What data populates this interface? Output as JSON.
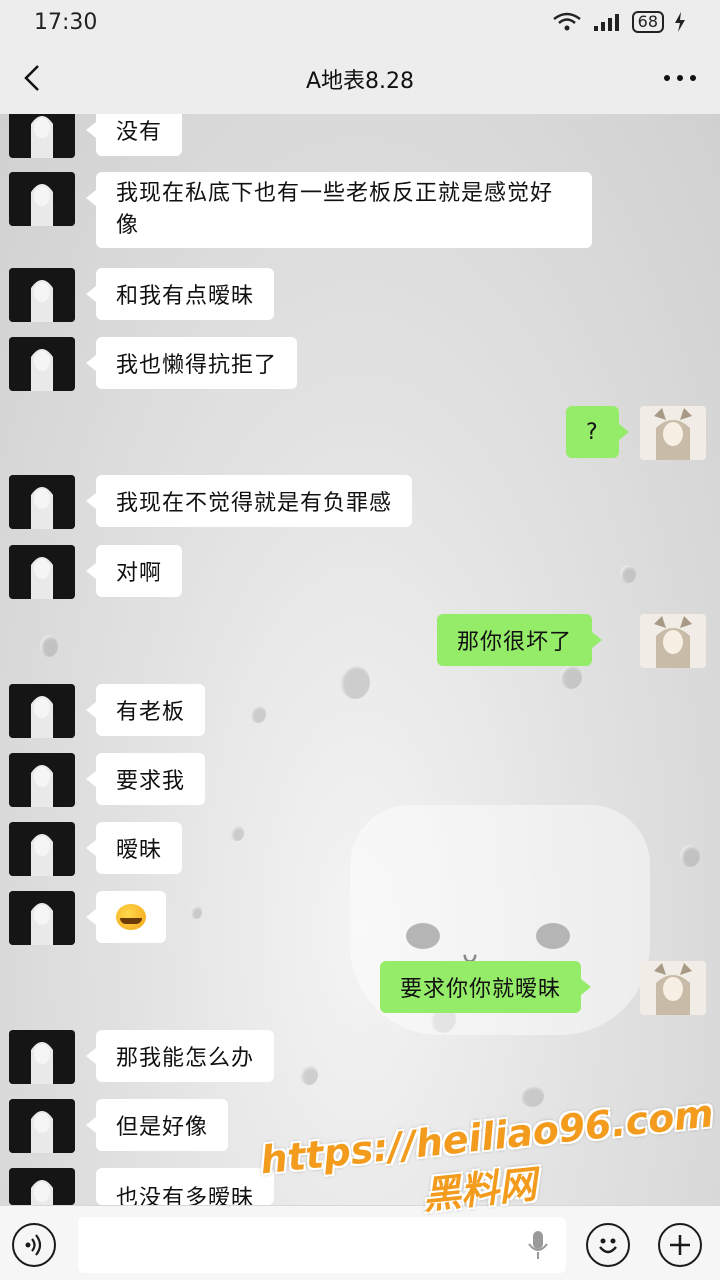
{
  "status": {
    "time": "17:30",
    "battery": "68"
  },
  "header": {
    "title": "A地表8.28"
  },
  "messages": [
    {
      "side": "other",
      "text": "没有"
    },
    {
      "side": "other",
      "text": "我现在私底下也有一些老板反正就是感觉好像"
    },
    {
      "side": "other",
      "text": "和我有点暧昧"
    },
    {
      "side": "other",
      "text": "我也懒得抗拒了"
    },
    {
      "side": "me",
      "text": "?"
    },
    {
      "side": "other",
      "text": "我现在不觉得就是有负罪感"
    },
    {
      "side": "other",
      "text": "对啊"
    },
    {
      "side": "me",
      "text": "那你很坏了"
    },
    {
      "side": "other",
      "text": "有老板"
    },
    {
      "side": "other",
      "text": "要求我"
    },
    {
      "side": "other",
      "text": "暧昧"
    },
    {
      "side": "other",
      "emoji": "laughing-crying-emoji"
    },
    {
      "side": "me",
      "text": "要求你你就暧昧"
    },
    {
      "side": "other",
      "text": "那我能怎么办"
    },
    {
      "side": "other",
      "text": "但是好像"
    },
    {
      "side": "other",
      "text": "也没有多暧昧"
    }
  ],
  "watermark": {
    "url": "https://heiliao96.com",
    "name": "黑料网"
  },
  "colors": {
    "sent_bubble": "#95ec69",
    "received_bubble": "#ffffff",
    "watermark": "#f29b1d"
  }
}
